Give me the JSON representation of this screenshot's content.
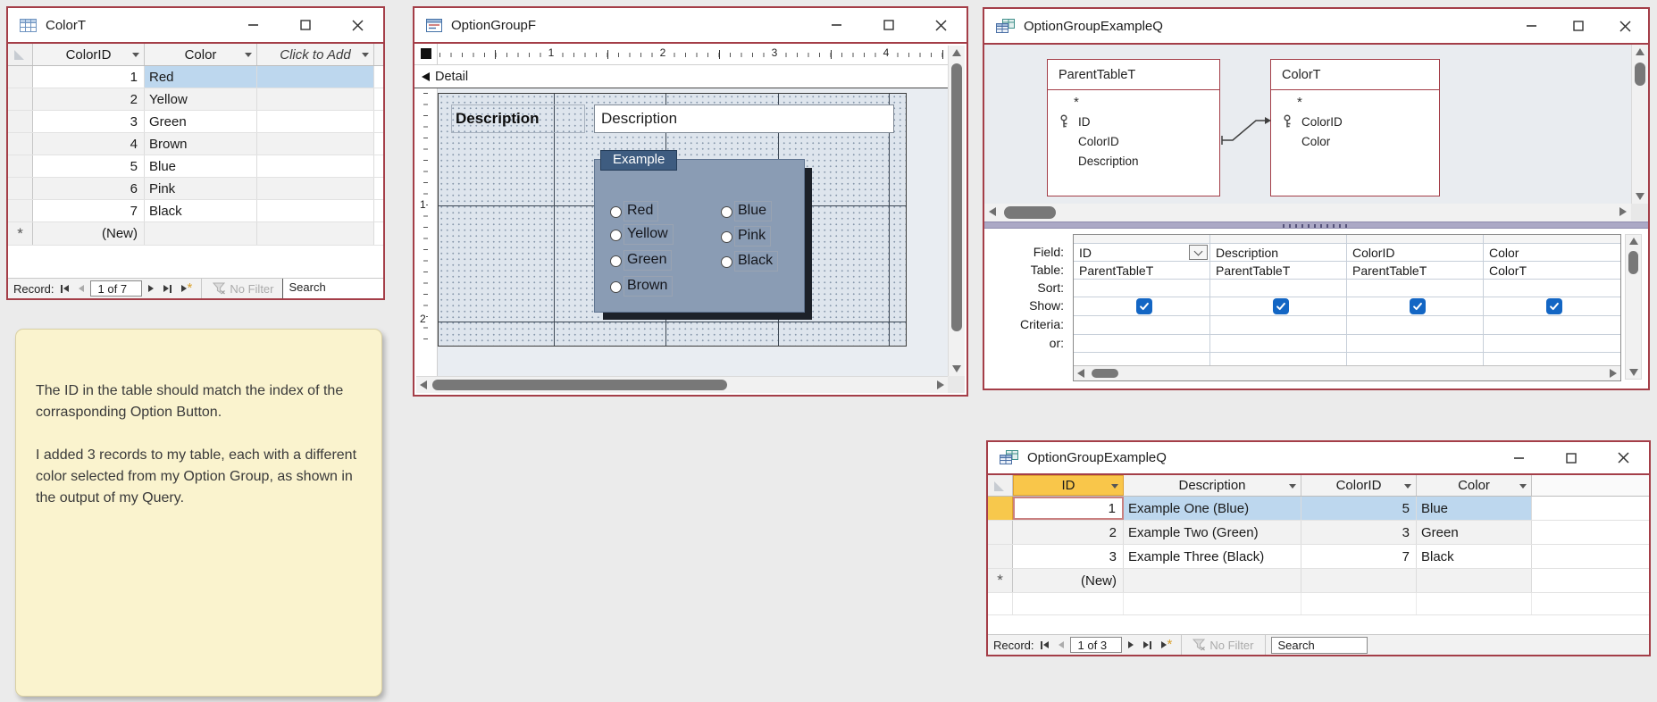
{
  "markers": {
    "new_star": "*"
  },
  "colors": {
    "window_border": "#A43E48",
    "selection": "#BDD7EE",
    "header_selected": "#F9C64A",
    "accent_blue": "#1366C4",
    "group_body": "#8A9CB4",
    "group_header": "#3E5C80",
    "note_bg": "#FAF3CE"
  },
  "colort": {
    "title": "ColorT",
    "columns": [
      "ColorID",
      "Color",
      "Click to Add"
    ],
    "rows": [
      {
        "id": "1",
        "color": "Red"
      },
      {
        "id": "2",
        "color": "Yellow"
      },
      {
        "id": "3",
        "color": "Green"
      },
      {
        "id": "4",
        "color": "Brown"
      },
      {
        "id": "5",
        "color": "Blue"
      },
      {
        "id": "6",
        "color": "Pink"
      },
      {
        "id": "7",
        "color": "Black"
      },
      {
        "id": "(New)",
        "color": ""
      }
    ],
    "nav": {
      "label": "Record:",
      "position": "1 of 7",
      "no_filter": "No Filter",
      "search": "Search"
    }
  },
  "note": {
    "para1": "The ID in the table should match the index of the corrasponding Option Button.",
    "para2": "I added 3 records to my table, each with a different color selected from my Option Group, as shown in the output of my Query."
  },
  "form": {
    "title": "OptionGroupF",
    "section": "Detail",
    "hruler": [
      "1",
      "2",
      "3",
      "4"
    ],
    "vruler": [
      "1",
      "2"
    ],
    "label_text": "Description",
    "textbox_text": "Description",
    "group_caption": "Example",
    "options_left": [
      "Red",
      "Yellow",
      "Green",
      "Brown"
    ],
    "options_right": [
      "Blue",
      "Pink",
      "Black"
    ]
  },
  "qdesign": {
    "title": "OptionGroupExampleQ",
    "tables": [
      {
        "name": "ParentTableT",
        "star": "*",
        "fields": [
          "ID",
          "ColorID",
          "Description"
        ]
      },
      {
        "name": "ColorT",
        "star": "*",
        "fields": [
          "ColorID",
          "Color"
        ]
      }
    ],
    "grid_labels": [
      "Field:",
      "Table:",
      "Sort:",
      "Show:",
      "Criteria:",
      "or:"
    ],
    "columns": [
      {
        "field": "ID",
        "table": "ParentTableT"
      },
      {
        "field": "Description",
        "table": "ParentTableT"
      },
      {
        "field": "ColorID",
        "table": "ParentTableT"
      },
      {
        "field": "Color",
        "table": "ColorT"
      }
    ]
  },
  "qresult": {
    "title": "OptionGroupExampleQ",
    "columns": [
      "ID",
      "Description",
      "ColorID",
      "Color"
    ],
    "rows": [
      {
        "id": "1",
        "description": "Example One (Blue)",
        "color_id": "5",
        "color": "Blue"
      },
      {
        "id": "2",
        "description": "Example Two (Green)",
        "color_id": "3",
        "color": "Green"
      },
      {
        "id": "3",
        "description": "Example Three (Black)",
        "color_id": "7",
        "color": "Black"
      },
      {
        "id": "(New)",
        "description": "",
        "color_id": "",
        "color": ""
      }
    ],
    "nav": {
      "label": "Record:",
      "position": "1 of 3",
      "no_filter": "No Filter",
      "search": "Search"
    }
  }
}
